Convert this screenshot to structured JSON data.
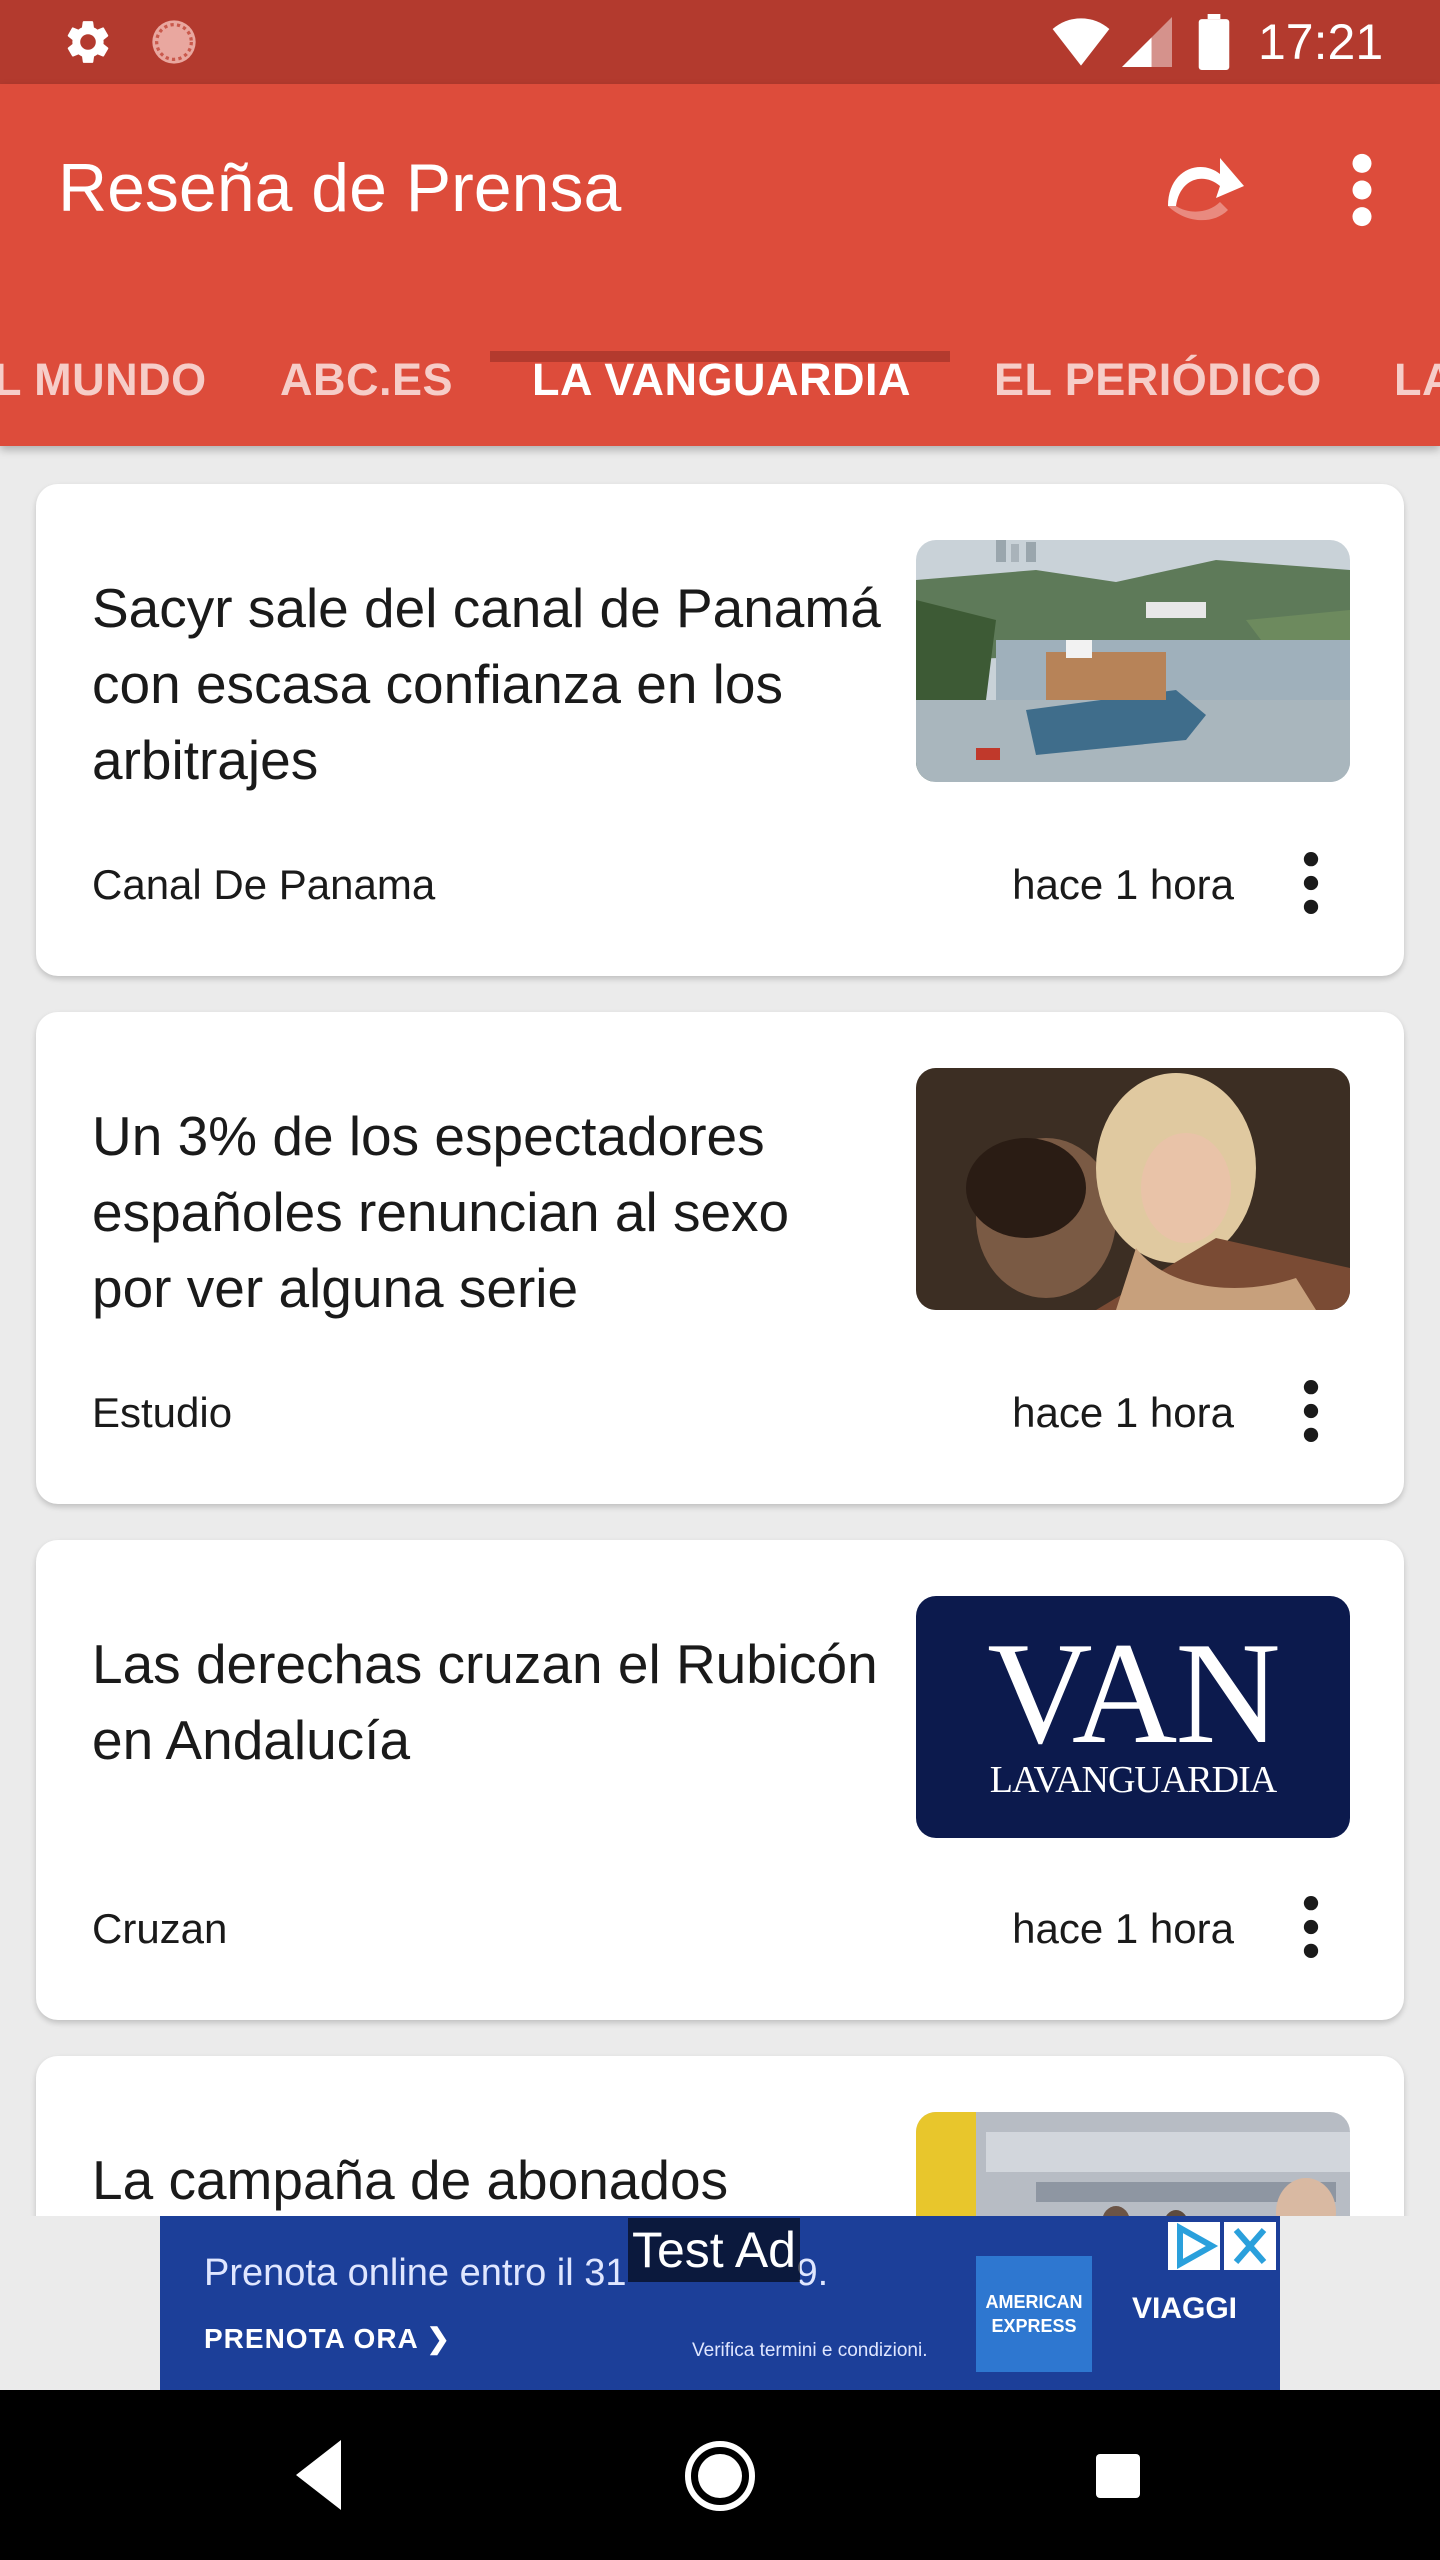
{
  "status_bar": {
    "time": "17:21",
    "icons": [
      "gear-icon",
      "sync-icon",
      "wifi-icon",
      "signal-icon",
      "battery-icon"
    ]
  },
  "app_bar": {
    "title": "Reseña de Prensa",
    "actions": [
      "refresh-icon",
      "more-vert-icon"
    ]
  },
  "tabs": [
    {
      "label": "L MUNDO"
    },
    {
      "label": "ABC.ES"
    },
    {
      "label": "LA VANGUARDIA",
      "active": true
    },
    {
      "label": "EL PERIÓDICO"
    },
    {
      "label": "LA"
    }
  ],
  "articles": [
    {
      "headline": "Sacyr sale del canal de Panamá con escasa confianza en los arbitrajes",
      "tag": "Canal De Panama",
      "time": "hace 1 hora",
      "image": "panama-canal-ship-photo"
    },
    {
      "headline": "Un 3% de los espectadores españoles renuncian al sexo por ver alguna serie",
      "tag": "Estudio",
      "time": "hace 1 hora",
      "image": "tv-series-couple-photo"
    },
    {
      "headline": "Las derechas cruzan el Rubicón en Andalucía",
      "tag": "Cruzan",
      "time": "hace 1 hora",
      "image": "la-vanguardia-logo",
      "logo_big": "VAN",
      "logo_small": "LAVANGUARDIA"
    },
    {
      "headline": "La campaña de abonados",
      "image": "office-people-photo"
    }
  ],
  "ad": {
    "badge": "Test Ad",
    "line1": "Prenota online entro il 31",
    "line1_tail": "9.",
    "cta": "PRENOTA ORA",
    "disclaimer": "Verifica termini e condizioni.",
    "brand_line1": "AMERICAN",
    "brand_line2": "EXPRESS",
    "product": "VIAGGI"
  },
  "colors": {
    "status_bar": "#b33a2e",
    "app_bar": "#dd4c3b",
    "tab_indicator": "#b33a2e",
    "background": "#ebebeb",
    "ad_background": "#1c3f99"
  }
}
